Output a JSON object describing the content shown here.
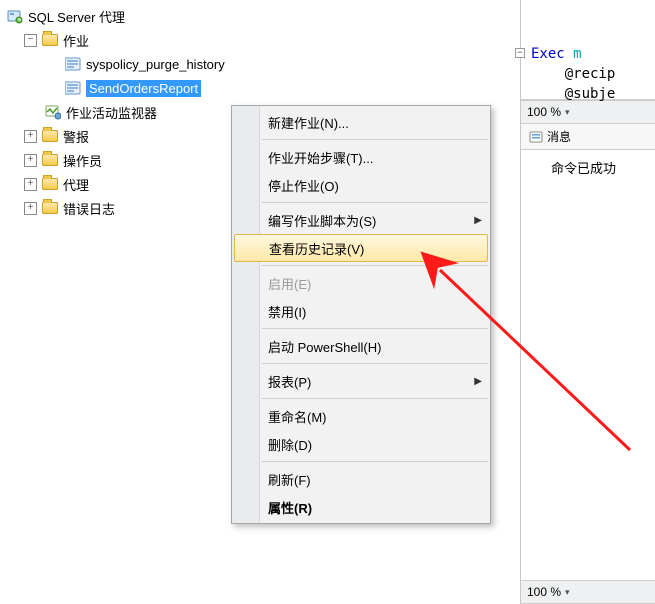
{
  "tree": {
    "root": "SQL Server 代理",
    "jobs_folder": "作业",
    "job1": "syspolicy_purge_history",
    "job2": "SendOrdersReport",
    "activity_monitor": "作业活动监视器",
    "alerts": "警报",
    "operators": "操作员",
    "proxies": "代理",
    "error_logs": "错误日志"
  },
  "menu": {
    "new_job": "新建作业(N)...",
    "start_step": "作业开始步骤(T)...",
    "stop_job": "停止作业(O)",
    "script_as": "编写作业脚本为(S)",
    "view_history": "查看历史记录(V)",
    "enable": "启用(E)",
    "disable": "禁用(I)",
    "powershell": "启动 PowerShell(H)",
    "reports": "报表(P)",
    "rename": "重命名(M)",
    "delete": "删除(D)",
    "refresh": "刷新(F)",
    "properties": "属性(R)"
  },
  "editor": {
    "line1_kw": "Exec",
    "line1_rest": " m",
    "line2": "@recip",
    "line3": "@subje",
    "zoom": "100 %",
    "messages_tab": "消息",
    "message_body": "命令已成功"
  }
}
